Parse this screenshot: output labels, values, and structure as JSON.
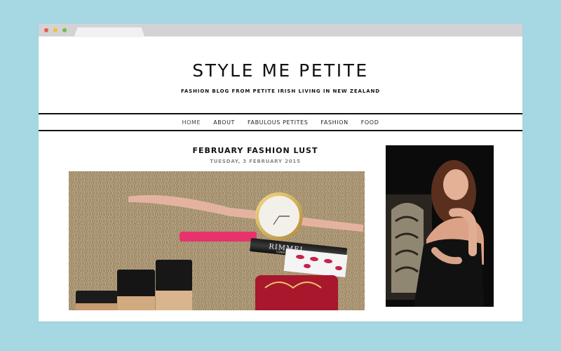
{
  "blog": {
    "title": "STYLE ME PETITE",
    "tagline": "FASHION BLOG FROM PETITE IRISH LIVING IN NEW ZEALAND"
  },
  "nav": {
    "items": [
      {
        "label": "HOME",
        "active": true
      },
      {
        "label": "ABOUT"
      },
      {
        "label": "FABULOUS PETITES"
      },
      {
        "label": "FASHION"
      },
      {
        "label": "FOOD"
      }
    ]
  },
  "post": {
    "title": "FEBRUARY FASHION LUST",
    "date": "TUESDAY, 3 FEBRUARY 2015",
    "image_texts": {
      "brand": "RIMMEL",
      "brand_sub": "LONDON"
    }
  },
  "colors": {
    "background": "#a6d8e4",
    "chrome": "#d3d3d6",
    "text": "#111111",
    "date": "#888888"
  },
  "icons": {
    "window_controls": [
      "close-icon",
      "minimize-icon",
      "maximize-icon"
    ]
  }
}
